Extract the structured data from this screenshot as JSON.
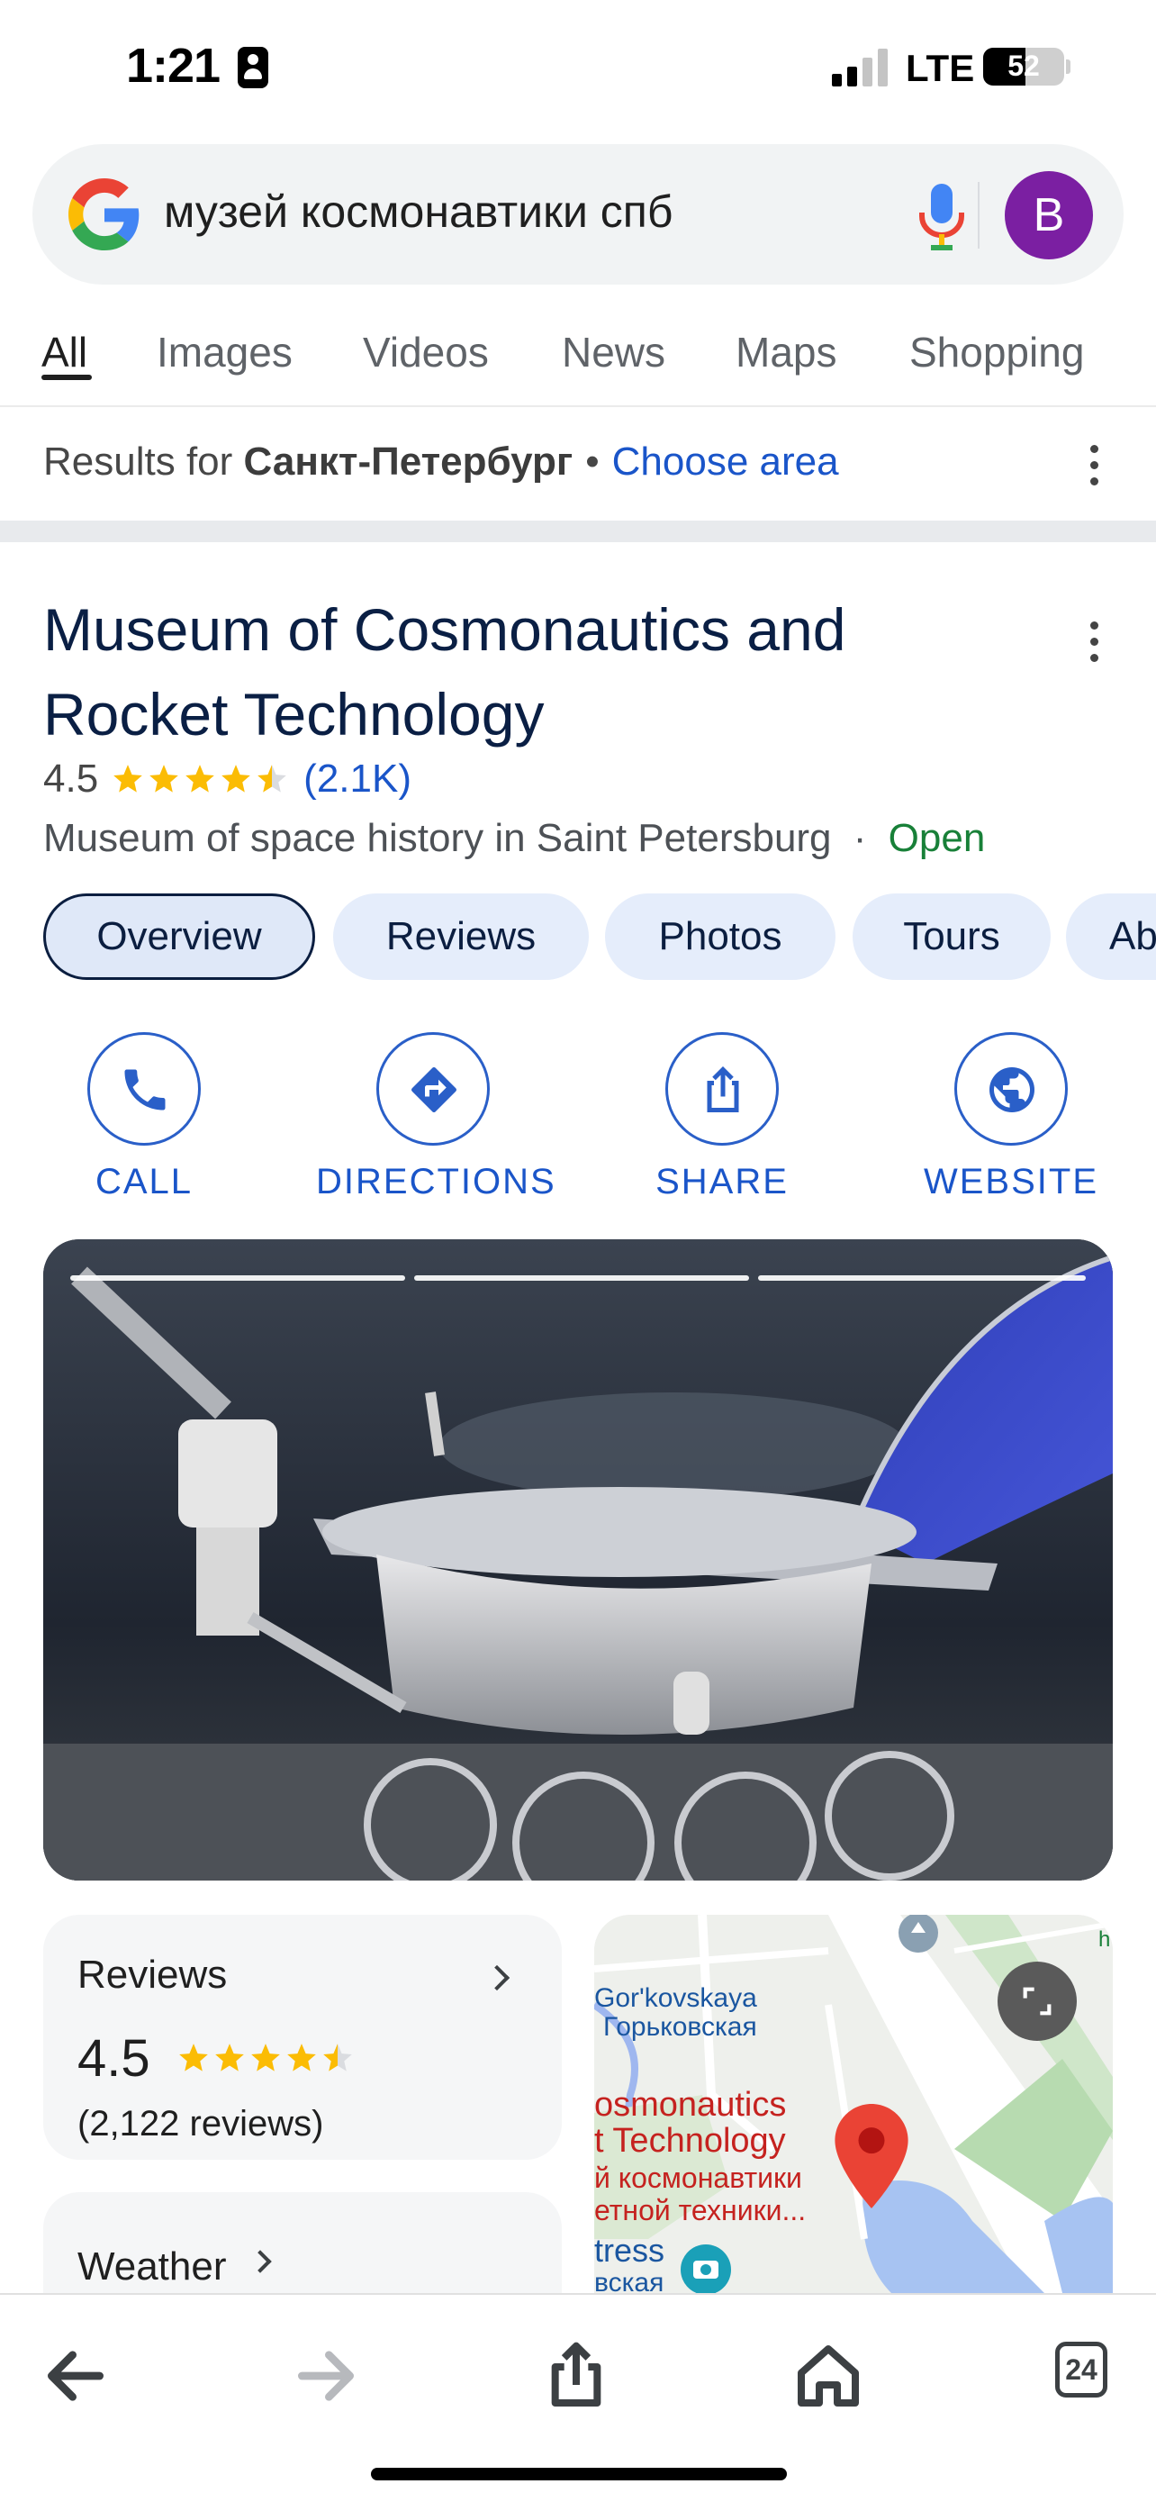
{
  "status_bar": {
    "time": "1:21",
    "network": "LTE",
    "battery": "52",
    "battery_level_percent": 52
  },
  "search": {
    "query": "музей космонавтики спб",
    "avatar_letter": "B"
  },
  "tabs": [
    {
      "label": "All",
      "active": true
    },
    {
      "label": "Images"
    },
    {
      "label": "Videos"
    },
    {
      "label": "News"
    },
    {
      "label": "Maps"
    },
    {
      "label": "Shopping"
    }
  ],
  "location": {
    "prefix": "Results for",
    "place": "Санкт-Петербург",
    "separator": "•",
    "change_link": "Choose area"
  },
  "place": {
    "name_line1": "Museum of Cosmonautics and",
    "name_line2": "Rocket Technology",
    "rating": "4.5",
    "rating_value": 4.5,
    "review_count_short": "(2.1K)",
    "category": "Museum of space history in Saint Petersburg",
    "separator": "·",
    "status": "Open",
    "chips": [
      {
        "label": "Overview",
        "active": true
      },
      {
        "label": "Reviews"
      },
      {
        "label": "Photos"
      },
      {
        "label": "Tours"
      },
      {
        "label": "Ab"
      }
    ],
    "actions": [
      {
        "label": "CALL",
        "icon": "phone-icon"
      },
      {
        "label": "DIRECTIONS",
        "icon": "directions-icon"
      },
      {
        "label": "SHARE",
        "icon": "share-icon"
      },
      {
        "label": "WEBSITE",
        "icon": "globe-icon"
      }
    ],
    "photo_slides": 3,
    "photo_current_slide": 1
  },
  "reviews_card": {
    "title": "Reviews",
    "rating": "4.5",
    "count": "(2,122 reviews)"
  },
  "weather_card": {
    "title": "Weather"
  },
  "map": {
    "label_metro_en": "Gor'kovskaya",
    "label_metro_ru": "Горьковская",
    "label_place_en_1": "osmonautics",
    "label_place_en_2": "t Technology",
    "label_place_ru_1": "й космонавтики",
    "label_place_ru_2": "етной техники...",
    "label_fortress_en": "tress",
    "label_fortress_ru": "вская",
    "label_edge": "h"
  },
  "bottom_bar": {
    "tab_count": "24"
  },
  "colors": {
    "link_blue": "#1a55c9",
    "open_green": "#188038",
    "star_yellow": "#fbbc04",
    "avatar_purple": "#7b1fa2"
  }
}
